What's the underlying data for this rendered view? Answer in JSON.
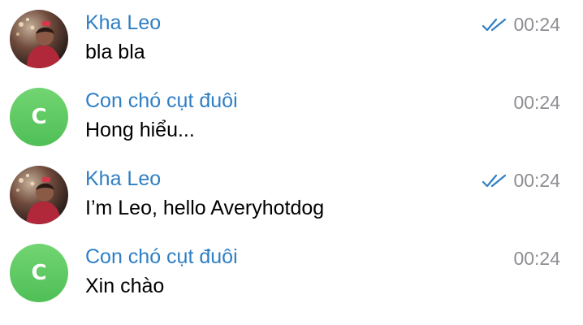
{
  "chats": [
    {
      "name": "Kha Leo",
      "message": "bla bla",
      "time": "00:24",
      "avatar": "photo",
      "read_receipt": true
    },
    {
      "name": "Con chó cụt đuôi",
      "message": "Hong hiểu...",
      "time": "00:24",
      "avatar": "letter",
      "avatar_letter": "C",
      "read_receipt": false
    },
    {
      "name": "Kha Leo",
      "message": "I’m Leo, hello Averyhotdog",
      "time": "00:24",
      "avatar": "photo",
      "read_receipt": true
    },
    {
      "name": "Con chó cụt đuôi",
      "message": "Xin chào",
      "time": "00:24",
      "avatar": "letter",
      "avatar_letter": "C",
      "read_receipt": false
    }
  ],
  "colors": {
    "name": "#2f7fc4",
    "message": "#000000",
    "time": "#8e8e93",
    "check": "#2f7fc4",
    "avatar_green": "#56c45c"
  }
}
